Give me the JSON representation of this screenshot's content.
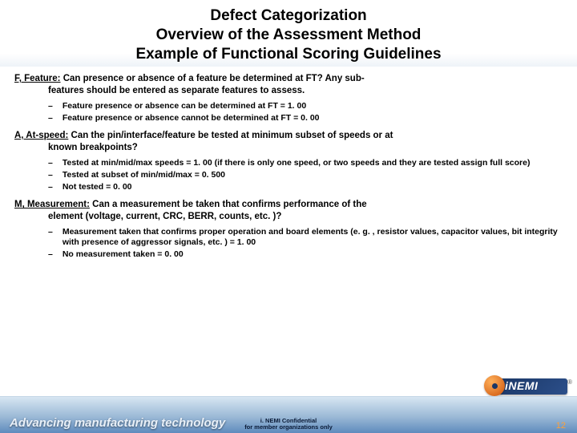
{
  "title": {
    "line1": "Defect Categorization",
    "line2": "Overview of the Assessment Method",
    "line3": "Example of Functional Scoring Guidelines"
  },
  "sections": [
    {
      "label": "F, Feature:",
      "desc_first": " Can presence or absence of a feature be determined at FT?  Any sub-",
      "desc_cont": "features should be entered as separate features to assess.",
      "bullets": [
        "Feature presence or absence can be determined at FT = 1. 00",
        "Feature presence or absence cannot be determined at FT = 0. 00"
      ]
    },
    {
      "label": "A, At-speed:",
      "desc_first": " Can the pin/interface/feature be tested at minimum subset of speeds or at",
      "desc_cont": "known breakpoints?",
      "bullets": [
        "Tested at min/mid/max speeds = 1. 00 (if there is only one speed, or two speeds and they are tested assign full score)",
        "Tested at subset of min/mid/max = 0. 500",
        "Not tested = 0. 00"
      ]
    },
    {
      "label": "M, Measurement:",
      "desc_first": " Can a measurement be taken that confirms performance of the",
      "desc_cont": "element (voltage, current, CRC, BERR, counts, etc. )?",
      "bullets": [
        "Measurement taken that confirms proper operation and board elements (e. g. , resistor values, capacitor values, bit integrity with presence of aggressor signals, etc. ) = 1. 00",
        "No measurement taken = 0. 00"
      ]
    }
  ],
  "footer": {
    "tagline": "Advancing manufacturing technology",
    "confidential_line1": "i. NEMI Confidential",
    "confidential_line2": "for member organizations only",
    "logo_text": "iNEMI",
    "page_number": "12"
  }
}
